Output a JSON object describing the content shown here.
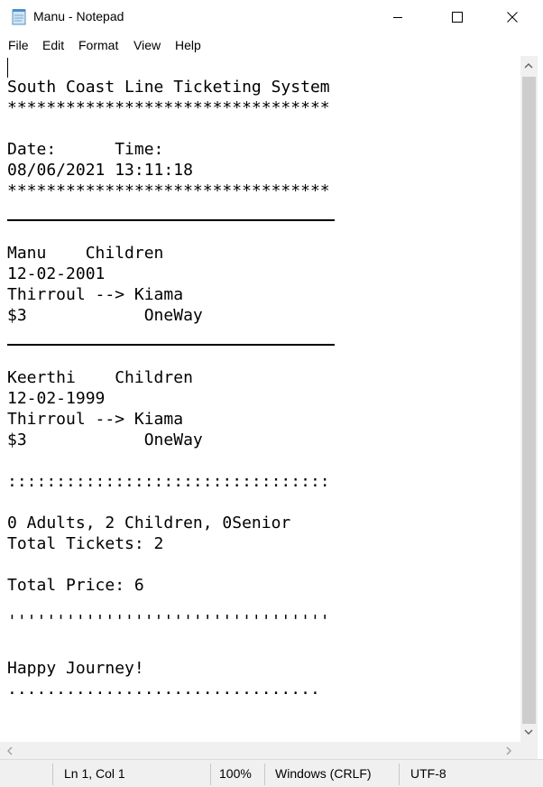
{
  "window": {
    "title": "Manu - Notepad",
    "icons": {
      "app": "notepad-icon",
      "minimize": "minimize-icon",
      "maximize": "maximize-icon",
      "close": "close-icon"
    }
  },
  "menu": [
    "File",
    "Edit",
    "Format",
    "View",
    "Help"
  ],
  "document": {
    "header": "South Coast Line Ticketing System",
    "stars1": "*********************************",
    "date_time_label": "Date:      Time:",
    "date_time_value": "08/06/2021 13:11:18",
    "stars2": "*********************************",
    "passengers": [
      {
        "name_type": "Manu    Children",
        "dob": "12-02-2001",
        "route": "Thirroul --> Kiama",
        "fare": "$3            OneWay"
      },
      {
        "name_type": "Keerthi    Children",
        "dob": "12-02-1999",
        "route": "Thirroul --> Kiama",
        "fare": "$3            OneWay"
      }
    ],
    "colons": ":::::::::::::::::::::::::::::::::",
    "counts": "0 Adults, 2 Children, 0Senior",
    "total_tickets": "Total Tickets: 2",
    "total_price": "Total Price: 6",
    "quotes": "'''''''''''''''''''''''''''''''''",
    "farewell": "Happy Journey!",
    "dots": "................................"
  },
  "status": {
    "position": "Ln 1, Col 1",
    "zoom": "100%",
    "line_ending": "Windows (CRLF)",
    "encoding": "UTF-8"
  },
  "colors": {
    "scroll_track": "#f0f0f0",
    "scroll_thumb": "#cdcdcd",
    "status_bar": "#f0f0f0"
  }
}
